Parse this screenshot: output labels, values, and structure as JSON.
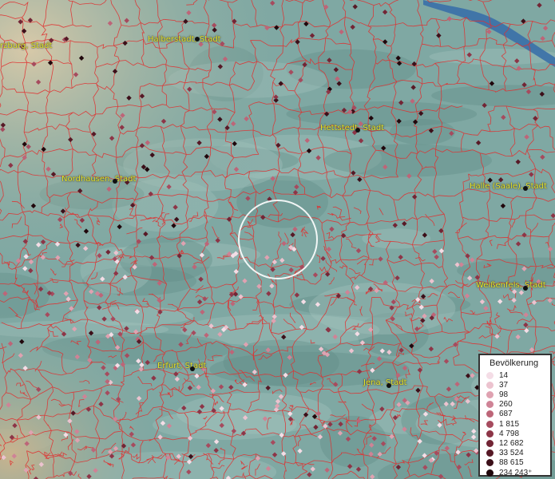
{
  "map": {
    "background_color": "#7fa8a3",
    "border_color": "#e03030",
    "river_color": "#3a6fa8"
  },
  "cities": [
    {
      "name": "rzburg, Stadt",
      "dot": false
    },
    {
      "name": "Halberstadt, Stadt",
      "dot": true
    },
    {
      "name": "Hettstedt, Stadt",
      "dot": true
    },
    {
      "name": "Nordhausen, Stadt",
      "dot": true
    },
    {
      "name": "Halle (Saale), Stadt",
      "dot": true
    },
    {
      "name": "Weißenfels, Stadt",
      "dot": true
    },
    {
      "name": "Erfurt, Stadt",
      "dot": true
    },
    {
      "name": "Jena, Stadt",
      "dot": true
    }
  ],
  "legend": {
    "title": "Bevölkerung",
    "items": [
      {
        "label": "14",
        "color": "#f4dde6"
      },
      {
        "label": "37",
        "color": "#ecc3cf"
      },
      {
        "label": "98",
        "color": "#dfa2b1"
      },
      {
        "label": "260",
        "color": "#cf8396"
      },
      {
        "label": "687",
        "color": "#bd6578"
      },
      {
        "label": "1 815",
        "color": "#a64b5e"
      },
      {
        "label": "4 798",
        "color": "#8d3547"
      },
      {
        "label": "12 682",
        "color": "#722535"
      },
      {
        "label": "33 524",
        "color": "#571926"
      },
      {
        "label": "88 615",
        "color": "#3c0f19"
      },
      {
        "label": "234 243⁺",
        "color": "#20070c"
      }
    ]
  }
}
